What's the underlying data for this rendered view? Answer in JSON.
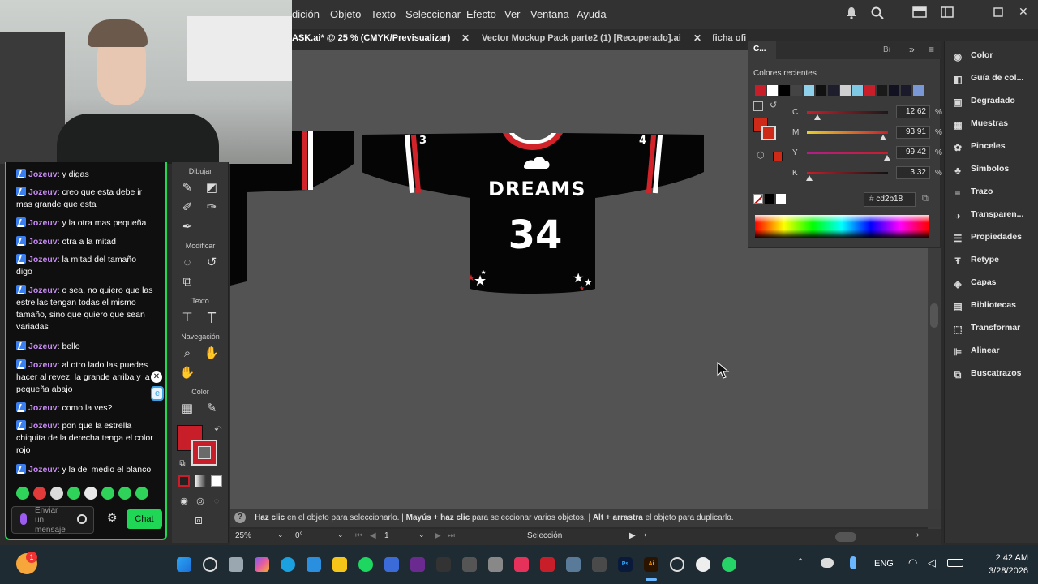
{
  "menu": [
    "dición",
    "Objeto",
    "Texto",
    "Seleccionar",
    "Efecto",
    "Ver",
    "Ventana",
    "Ayuda"
  ],
  "tabs": [
    {
      "label": "ASK.ai* @ 25 % (CMYK/Previsualizar)",
      "active": true
    },
    {
      "label": "Vector Mockup Pack parte2  (1) [Recuperado].ai",
      "active": false
    },
    {
      "label": "ficha ofi",
      "active": false
    }
  ],
  "toolbar": {
    "group_draw": "Dibujar",
    "group_modify": "Modificar",
    "group_text": "Texto",
    "group_nav": "Navegación",
    "group_color": "Color"
  },
  "chat": {
    "messages": [
      {
        "user": "Jozeuv",
        "text": ": y digas"
      },
      {
        "user": "Jozeuv",
        "text": ": creo que esta debe ir mas grande que esta"
      },
      {
        "user": "Jozeuv",
        "text": ": y la otra mas pequeña"
      },
      {
        "user": "Jozeuv",
        "text": ": otra a la mitad"
      },
      {
        "user": "Jozeuv",
        "text": ": la mitad del tamaño digo"
      },
      {
        "user": "Jozeuv",
        "text": ": o sea, no quiero que las estrellas tengan todas el mismo tamaño, sino que quiero que sean variadas"
      },
      {
        "user": "Jozeuv",
        "text": ": bello"
      },
      {
        "user": "Jozeuv",
        "text": ": al otro lado las puedes hacer al revez, la grande arriba y la pequeña abajo"
      },
      {
        "user": "Jozeuv",
        "text": ": como la ves?"
      },
      {
        "user": "Jozeuv",
        "text": ": pon que la estrella chiquita de la derecha tenga el color rojo"
      },
      {
        "user": "Jozeuv",
        "text": ": y la del medio el blanco"
      }
    ],
    "input_placeholder": "Enviar un mensaje",
    "send_label": "Chat"
  },
  "jersey": {
    "wordmark": "DREAMS",
    "number": "34",
    "sleeve_left": "3",
    "sleeve_right": "4"
  },
  "color_panel": {
    "tab_label": "C...",
    "tab_b": "Bı",
    "recent_label": "Colores recientes",
    "recent_colors": [
      "#c81e2a",
      "#ffffff",
      "#000000",
      "#444444",
      "#8fd0ea",
      "#111111",
      "#1d1d2b",
      "#cfcfcf",
      "#7ec8e3",
      "#c81e2a",
      "#1a1a1a",
      "#111122",
      "#1a1a2a",
      "#7a98d6"
    ],
    "sliders": [
      {
        "label": "C",
        "value": "12.62",
        "fill": 0.1262
      },
      {
        "label": "M",
        "value": "93.91",
        "fill": 0.9391
      },
      {
        "label": "Y",
        "value": "99.42",
        "fill": 0.9942
      },
      {
        "label": "K",
        "value": "3.32",
        "fill": 0.0332
      }
    ],
    "pct": "%",
    "hex": "cd2b18",
    "fill_color": "#cd2b18"
  },
  "right_panel": [
    {
      "label": "Color",
      "icon": "palette-icon"
    },
    {
      "label": "Guía de col...",
      "icon": "color-guide-icon"
    },
    {
      "label": "Degradado",
      "icon": "gradient-icon"
    },
    {
      "label": "Muestras",
      "icon": "swatches-icon"
    },
    {
      "label": "Pinceles",
      "icon": "brushes-icon"
    },
    {
      "label": "Símbolos",
      "icon": "symbols-icon"
    },
    {
      "label": "Trazo",
      "icon": "stroke-icon"
    },
    {
      "label": "Transparen...",
      "icon": "transparency-icon"
    },
    {
      "label": "Propiedades",
      "icon": "properties-icon"
    },
    {
      "label": "Retype",
      "icon": "retype-icon"
    },
    {
      "label": "Capas",
      "icon": "layers-icon"
    },
    {
      "label": "Bibliotecas",
      "icon": "libraries-icon"
    },
    {
      "label": "Transformar",
      "icon": "transform-icon"
    },
    {
      "label": "Alinear",
      "icon": "align-icon"
    },
    {
      "label": "Buscatrazos",
      "icon": "pathfinder-icon"
    }
  ],
  "status": {
    "part1_bold": "Haz clic",
    "part1": " en el objeto para seleccionarlo.  |  ",
    "part2_bold": "Mayús + haz clic",
    "part2": " para seleccionar varios objetos.  |  ",
    "part3_bold": "Alt + arrastra",
    "part3": " el objeto para duplicarlo."
  },
  "bottom": {
    "zoom": "25%",
    "rotation": "0°",
    "artboard": "1",
    "tool": "Selección"
  },
  "taskbar": {
    "lang": "ENG",
    "time": "2:42 AM",
    "date": "3/28/2026",
    "badge": "1"
  }
}
